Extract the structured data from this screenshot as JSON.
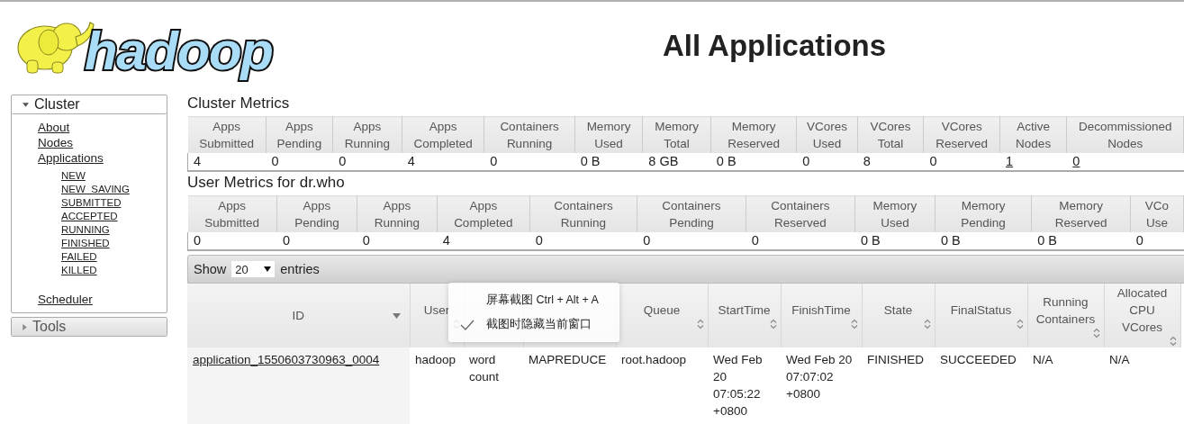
{
  "logo": {
    "text": "hadoop"
  },
  "title": "All Applications",
  "sidebar": {
    "sections": [
      {
        "label": "Cluster",
        "expanded": true,
        "items": [
          {
            "label": "About"
          },
          {
            "label": "Nodes"
          },
          {
            "label": "Applications",
            "children": [
              {
                "label": "NEW"
              },
              {
                "label": "NEW_SAVING"
              },
              {
                "label": "SUBMITTED"
              },
              {
                "label": "ACCEPTED"
              },
              {
                "label": "RUNNING"
              },
              {
                "label": "FINISHED"
              },
              {
                "label": "FAILED"
              },
              {
                "label": "KILLED"
              }
            ]
          },
          {
            "label": "Scheduler"
          }
        ]
      },
      {
        "label": "Tools",
        "expanded": false
      }
    ]
  },
  "cluster_metrics": {
    "title": "Cluster Metrics",
    "columns": [
      {
        "lines": [
          "Apps",
          "Submitted"
        ],
        "value": "4"
      },
      {
        "lines": [
          "Apps",
          "Pending"
        ],
        "value": "0"
      },
      {
        "lines": [
          "Apps",
          "Running"
        ],
        "value": "0"
      },
      {
        "lines": [
          "Apps",
          "Completed"
        ],
        "value": "4"
      },
      {
        "lines": [
          "Containers",
          "Running"
        ],
        "value": "0"
      },
      {
        "lines": [
          "Memory",
          "Used"
        ],
        "value": "0 B"
      },
      {
        "lines": [
          "Memory",
          "Total"
        ],
        "value": "8 GB"
      },
      {
        "lines": [
          "Memory",
          "Reserved"
        ],
        "value": "0 B"
      },
      {
        "lines": [
          "VCores",
          "Used"
        ],
        "value": "0"
      },
      {
        "lines": [
          "VCores",
          "Total"
        ],
        "value": "8"
      },
      {
        "lines": [
          "VCores",
          "Reserved"
        ],
        "value": "0"
      },
      {
        "lines": [
          "Active",
          "Nodes"
        ],
        "value": "1",
        "link": true
      },
      {
        "lines": [
          "Decommissioned",
          "Nodes"
        ],
        "value": "0",
        "link": true
      }
    ]
  },
  "user_metrics": {
    "title": "User Metrics for dr.who",
    "columns": [
      {
        "lines": [
          "Apps",
          "Submitted"
        ],
        "value": "0"
      },
      {
        "lines": [
          "Apps",
          "Pending"
        ],
        "value": "0"
      },
      {
        "lines": [
          "Apps",
          "Running"
        ],
        "value": "0"
      },
      {
        "lines": [
          "Apps",
          "Completed"
        ],
        "value": "4"
      },
      {
        "lines": [
          "Containers",
          "Running"
        ],
        "value": "0"
      },
      {
        "lines": [
          "Containers",
          "Pending"
        ],
        "value": "0"
      },
      {
        "lines": [
          "Containers",
          "Reserved"
        ],
        "value": "0"
      },
      {
        "lines": [
          "Memory",
          "Used"
        ],
        "value": "0 B"
      },
      {
        "lines": [
          "Memory",
          "Pending"
        ],
        "value": "0 B"
      },
      {
        "lines": [
          "Memory",
          "Reserved"
        ],
        "value": "0 B"
      },
      {
        "lines": [
          "VCo",
          "Use"
        ],
        "value": "0"
      }
    ]
  },
  "applications": {
    "length_control": {
      "prefix": "Show",
      "value": "20",
      "suffix": "entries"
    },
    "columns": [
      {
        "lines": [
          "ID"
        ],
        "sorted": true
      },
      {
        "lines": [
          "User"
        ],
        "sorted": false
      },
      {},
      {},
      {
        "lines": [
          "Queue"
        ],
        "sorted": false
      },
      {
        "lines": [
          "StartTime"
        ],
        "sorted": false
      },
      {
        "lines": [
          "FinishTime"
        ],
        "sorted": false
      },
      {
        "lines": [
          "State"
        ],
        "sorted": false
      },
      {
        "lines": [
          "FinalStatus"
        ],
        "sorted": false
      },
      {
        "lines": [
          "Running",
          "Containers"
        ],
        "sorted": false
      },
      {
        "lines": [
          "Allocated",
          "CPU",
          "VCores"
        ],
        "sorted": false
      }
    ],
    "rows": [
      {
        "cells": [
          {
            "text": "application_1550603730963_0004",
            "link": true
          },
          {
            "text": "hadoop"
          },
          {
            "text": "word count"
          },
          {
            "text": "MAPREDUCE"
          },
          {
            "text": "root.hadoop"
          },
          {
            "text": "Wed Feb 20 07:05:22 +0800"
          },
          {
            "text": "Wed Feb 20 07:07:02 +0800"
          },
          {
            "text": "FINISHED"
          },
          {
            "text": "SUCCEEDED"
          },
          {
            "text": "N/A"
          },
          {
            "text": "N/A"
          }
        ]
      }
    ]
  },
  "context_menu": {
    "items": [
      {
        "label": "屏幕截图 Ctrl + Alt + A",
        "checked": false
      },
      {
        "label": "截图时隐藏当前窗口",
        "checked": true
      }
    ]
  }
}
